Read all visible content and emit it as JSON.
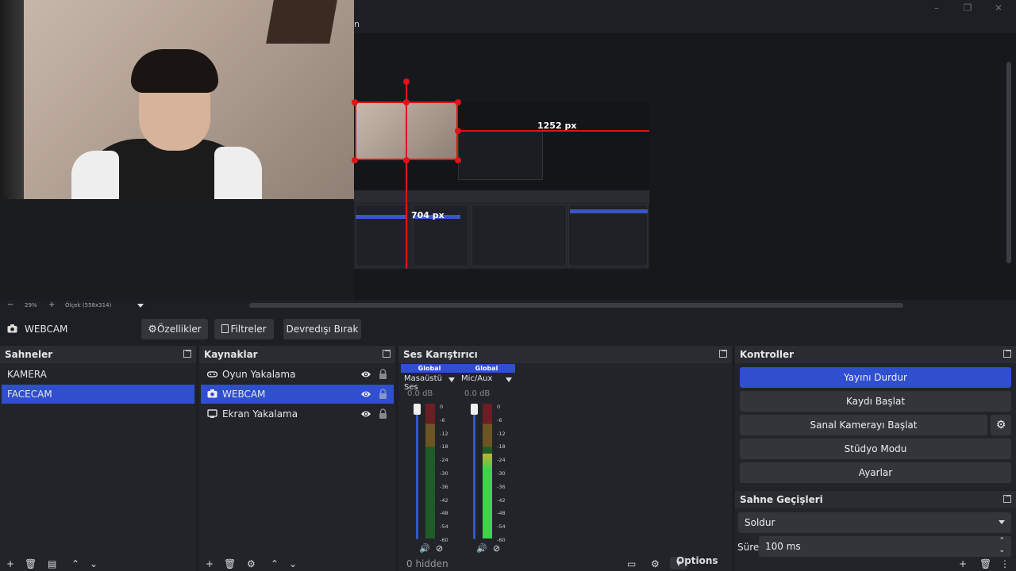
{
  "window": {
    "title_fragment": "n",
    "minimize": "–",
    "restore": "❐",
    "close": "✕"
  },
  "preview": {
    "width_label": "1252 px",
    "height_label": "704 px"
  },
  "zoom": {
    "minus": "−",
    "percent": "29%",
    "plus": "+",
    "scale_label": "Ölçek (558x314)"
  },
  "source_toolbar": {
    "selected_source": "WEBCAM",
    "properties": "Özellikler",
    "filters": "Filtreler",
    "deactivate": "Devredışı Bırak"
  },
  "scenes": {
    "title": "Sahneler",
    "items": [
      {
        "label": "KAMERA",
        "selected": false
      },
      {
        "label": "FACECAM",
        "selected": true
      }
    ]
  },
  "sources": {
    "title": "Kaynaklar",
    "items": [
      {
        "label": "Oyun Yakalama",
        "icon": "gamepad-icon",
        "selected": false
      },
      {
        "label": "WEBCAM",
        "icon": "camera-icon",
        "selected": true
      },
      {
        "label": "Ekran Yakalama",
        "icon": "monitor-icon",
        "selected": false
      }
    ]
  },
  "mixer": {
    "title": "Ses Karıştırıcı",
    "channels": [
      {
        "badge": "Global",
        "name": "Masaüstü Ses",
        "db": "0.0 dB",
        "level": 0.0
      },
      {
        "badge": "Global",
        "name": "Mic/Aux",
        "db": "0.0 dB",
        "level": 0.63
      }
    ],
    "scale": [
      "0",
      "-6",
      "-12",
      "-18",
      "-24",
      "-30",
      "-36",
      "-42",
      "-48",
      "-54",
      "-60"
    ],
    "footer_text": "0 hidden",
    "options": "Options"
  },
  "controls": {
    "title": "Kontroller",
    "stop_stream": "Yayını Durdur",
    "start_record": "Kaydı Başlat",
    "virtual_cam": "Sanal Kamerayı Başlat",
    "studio_mode": "Stüdyo Modu",
    "settings": "Ayarlar"
  },
  "transitions": {
    "title": "Sahne Geçişleri",
    "selected": "Soldur",
    "duration_label": "Süre",
    "duration_value": "100 ms"
  },
  "colors": {
    "accent": "#2f4fcf",
    "guide_red": "#e0121a",
    "dock_bg": "#22242a"
  }
}
